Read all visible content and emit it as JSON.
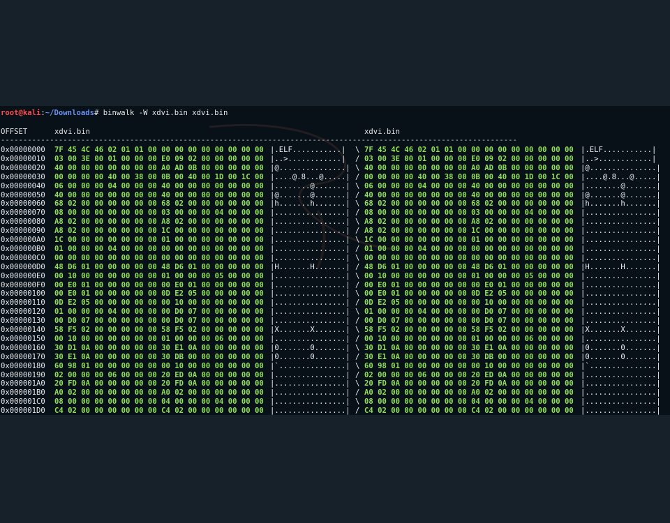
{
  "colors": {
    "page_background": "#16212a",
    "terminal_background": "#091118",
    "prompt_user": "#ff4b4b",
    "prompt_path": "#6a8ff2",
    "hex_bytes": "#8fe058",
    "text": "#e2e6e8"
  },
  "prompt": {
    "user_host": "root@kali",
    "separator": ":",
    "path": "~/Downloads",
    "symbol": "#",
    "command": " binwalk -W xdvi.bin xdvi.bin"
  },
  "header": {
    "offset_label": "OFFSET",
    "file1_name": "xdvi.bin",
    "file2_name": "xdvi.bin",
    "separator": "--------------------------------------------------------------------------------------------------------------------"
  },
  "rows": [
    {
      "offset": "0x00000000",
      "hex1": "7F 45 4C 46 02 01 01 00 00 00 00 00 00 00 00 00",
      "ascii1": "|.ELF...........|",
      "dir": "\\",
      "hex2": "7F 45 4C 46 02 01 01 00 00 00 00 00 00 00 00 00",
      "ascii2": "|.ELF...........|"
    },
    {
      "offset": "0x00000010",
      "hex1": "03 00 3E 00 01 00 00 00 E0 09 02 00 00 00 00 00",
      "ascii1": "|..>............|",
      "dir": "/",
      "hex2": "03 00 3E 00 01 00 00 00 E0 09 02 00 00 00 00 00",
      "ascii2": "|..>............|"
    },
    {
      "offset": "0x00000020",
      "hex1": "40 00 00 00 00 00 00 00 A0 AD 0B 00 00 00 00 00",
      "ascii1": "|@...............|",
      "dir": "\\",
      "hex2": "40 00 00 00 00 00 00 00 A0 AD 0B 00 00 00 00 00",
      "ascii2": "|@...............|"
    },
    {
      "offset": "0x00000030",
      "hex1": "00 00 00 00 40 00 38 00 0B 00 40 00 1D 00 1C 00",
      "ascii1": "|....@.8...@.....|",
      "dir": "/",
      "hex2": "00 00 00 00 40 00 38 00 0B 00 40 00 1D 00 1C 00",
      "ascii2": "|....@.8...@.....|"
    },
    {
      "offset": "0x00000040",
      "hex1": "06 00 00 00 04 00 00 00 40 00 00 00 00 00 00 00",
      "ascii1": "|........@.......|",
      "dir": "\\",
      "hex2": "06 00 00 00 04 00 00 00 40 00 00 00 00 00 00 00",
      "ascii2": "|........@.......|"
    },
    {
      "offset": "0x00000050",
      "hex1": "40 00 00 00 00 00 00 00 40 00 00 00 00 00 00 00",
      "ascii1": "|@.......@.......|",
      "dir": "/",
      "hex2": "40 00 00 00 00 00 00 00 40 00 00 00 00 00 00 00",
      "ascii2": "|@.......@.......|"
    },
    {
      "offset": "0x00000060",
      "hex1": "68 02 00 00 00 00 00 00 68 02 00 00 00 00 00 00",
      "ascii1": "|h.......h.......|",
      "dir": "\\",
      "hex2": "68 02 00 00 00 00 00 00 68 02 00 00 00 00 00 00",
      "ascii2": "|h.......h.......|"
    },
    {
      "offset": "0x00000070",
      "hex1": "08 00 00 00 00 00 00 00 03 00 00 00 04 00 00 00",
      "ascii1": "|................|",
      "dir": "/",
      "hex2": "08 00 00 00 00 00 00 00 03 00 00 00 04 00 00 00",
      "ascii2": "|................|"
    },
    {
      "offset": "0x00000080",
      "hex1": "A8 02 00 00 00 00 00 00 A8 02 00 00 00 00 00 00",
      "ascii1": "|................|",
      "dir": "\\",
      "hex2": "A8 02 00 00 00 00 00 00 A8 02 00 00 00 00 00 00",
      "ascii2": "|................|"
    },
    {
      "offset": "0x00000090",
      "hex1": "A8 02 00 00 00 00 00 00 1C 00 00 00 00 00 00 00",
      "ascii1": "|................|",
      "dir": "/",
      "hex2": "A8 02 00 00 00 00 00 00 1C 00 00 00 00 00 00 00",
      "ascii2": "|................|"
    },
    {
      "offset": "0x000000A0",
      "hex1": "1C 00 00 00 00 00 00 00 01 00 00 00 00 00 00 00",
      "ascii1": "|................|",
      "dir": "\\",
      "hex2": "1C 00 00 00 00 00 00 00 01 00 00 00 00 00 00 00",
      "ascii2": "|................|"
    },
    {
      "offset": "0x000000B0",
      "hex1": "01 00 00 00 04 00 00 00 00 00 00 00 00 00 00 00",
      "ascii1": "|................|",
      "dir": "/",
      "hex2": "01 00 00 00 04 00 00 00 00 00 00 00 00 00 00 00",
      "ascii2": "|................|"
    },
    {
      "offset": "0x000000C0",
      "hex1": "00 00 00 00 00 00 00 00 00 00 00 00 00 00 00 00",
      "ascii1": "|................|",
      "dir": "\\",
      "hex2": "00 00 00 00 00 00 00 00 00 00 00 00 00 00 00 00",
      "ascii2": "|................|"
    },
    {
      "offset": "0x000000D0",
      "hex1": "48 D6 01 00 00 00 00 00 48 D6 01 00 00 00 00 00",
      "ascii1": "|H.......H.......|",
      "dir": "/",
      "hex2": "48 D6 01 00 00 00 00 00 48 D6 01 00 00 00 00 00",
      "ascii2": "|H.......H.......|"
    },
    {
      "offset": "0x000000E0",
      "hex1": "00 10 00 00 00 00 00 00 01 00 00 00 05 00 00 00",
      "ascii1": "|................|",
      "dir": "\\",
      "hex2": "00 10 00 00 00 00 00 00 01 00 00 00 05 00 00 00",
      "ascii2": "|................|"
    },
    {
      "offset": "0x000000F0",
      "hex1": "00 E0 01 00 00 00 00 00 00 E0 01 00 00 00 00 00",
      "ascii1": "|................|",
      "dir": "/",
      "hex2": "00 E0 01 00 00 00 00 00 00 E0 01 00 00 00 00 00",
      "ascii2": "|................|"
    },
    {
      "offset": "0x00000100",
      "hex1": "00 E0 01 00 00 00 00 00 0D E2 05 00 00 00 00 00",
      "ascii1": "|................|",
      "dir": "\\",
      "hex2": "00 E0 01 00 00 00 00 00 0D E2 05 00 00 00 00 00",
      "ascii2": "|................|"
    },
    {
      "offset": "0x00000110",
      "hex1": "0D E2 05 00 00 00 00 00 00 10 00 00 00 00 00 00",
      "ascii1": "|................|",
      "dir": "/",
      "hex2": "0D E2 05 00 00 00 00 00 00 10 00 00 00 00 00 00",
      "ascii2": "|................|"
    },
    {
      "offset": "0x00000120",
      "hex1": "01 00 00 00 04 00 00 00 00 D0 07 00 00 00 00 00",
      "ascii1": "|................|",
      "dir": "\\",
      "hex2": "01 00 00 00 04 00 00 00 00 D0 07 00 00 00 00 00",
      "ascii2": "|................|"
    },
    {
      "offset": "0x00000130",
      "hex1": "00 D0 07 00 00 00 00 00 00 D0 07 00 00 00 00 00",
      "ascii1": "|................|",
      "dir": "/",
      "hex2": "00 D0 07 00 00 00 00 00 00 D0 07 00 00 00 00 00",
      "ascii2": "|................|"
    },
    {
      "offset": "0x00000140",
      "hex1": "58 F5 02 00 00 00 00 00 58 F5 02 00 00 00 00 00",
      "ascii1": "|X.......X.......|",
      "dir": "\\",
      "hex2": "58 F5 02 00 00 00 00 00 58 F5 02 00 00 00 00 00",
      "ascii2": "|X.......X.......|"
    },
    {
      "offset": "0x00000150",
      "hex1": "00 10 00 00 00 00 00 00 01 00 00 00 06 00 00 00",
      "ascii1": "|................|",
      "dir": "/",
      "hex2": "00 10 00 00 00 00 00 00 01 00 00 00 06 00 00 00",
      "ascii2": "|................|"
    },
    {
      "offset": "0x00000160",
      "hex1": "30 D1 0A 00 00 00 00 00 30 E1 0A 00 00 00 00 00",
      "ascii1": "|0.......0.......|",
      "dir": "\\",
      "hex2": "30 D1 0A 00 00 00 00 00 30 E1 0A 00 00 00 00 00",
      "ascii2": "|0.......0.......|"
    },
    {
      "offset": "0x00000170",
      "hex1": "30 E1 0A 00 00 00 00 00 30 DB 00 00 00 00 00 00",
      "ascii1": "|0.......0.......|",
      "dir": "/",
      "hex2": "30 E1 0A 00 00 00 00 00 30 DB 00 00 00 00 00 00",
      "ascii2": "|0.......0.......|"
    },
    {
      "offset": "0x00000180",
      "hex1": "60 98 01 00 00 00 00 00 00 10 00 00 00 00 00 00",
      "ascii1": "|`...............|",
      "dir": "\\",
      "hex2": "60 98 01 00 00 00 00 00 00 10 00 00 00 00 00 00",
      "ascii2": "|`...............|"
    },
    {
      "offset": "0x00000190",
      "hex1": "02 00 00 00 06 00 00 00 20 ED 0A 00 00 00 00 00",
      "ascii1": "|................|",
      "dir": "/",
      "hex2": "02 00 00 00 06 00 00 00 20 ED 0A 00 00 00 00 00",
      "ascii2": "|................|"
    },
    {
      "offset": "0x000001A0",
      "hex1": "20 FD 0A 00 00 00 00 00 20 FD 0A 00 00 00 00 00",
      "ascii1": "|................|",
      "dir": "\\",
      "hex2": "20 FD 0A 00 00 00 00 00 20 FD 0A 00 00 00 00 00",
      "ascii2": "|................|"
    },
    {
      "offset": "0x000001B0",
      "hex1": "A0 02 00 00 00 00 00 00 A0 02 00 00 00 00 00 00",
      "ascii1": "|................|",
      "dir": "/",
      "hex2": "A0 02 00 00 00 00 00 00 A0 02 00 00 00 00 00 00",
      "ascii2": "|................|"
    },
    {
      "offset": "0x000001C0",
      "hex1": "08 00 00 00 00 00 00 00 04 00 00 00 04 00 00 00",
      "ascii1": "|................|",
      "dir": "\\",
      "hex2": "08 00 00 00 00 00 00 00 04 00 00 00 04 00 00 00",
      "ascii2": "|................|"
    },
    {
      "offset": "0x000001D0",
      "hex1": "C4 02 00 00 00 00 00 00 C4 02 00 00 00 00 00 00",
      "ascii1": "|................|",
      "dir": "/",
      "hex2": "C4 02 00 00 00 00 00 00 C4 02 00 00 00 00 00 00",
      "ascii2": "|................|"
    }
  ]
}
